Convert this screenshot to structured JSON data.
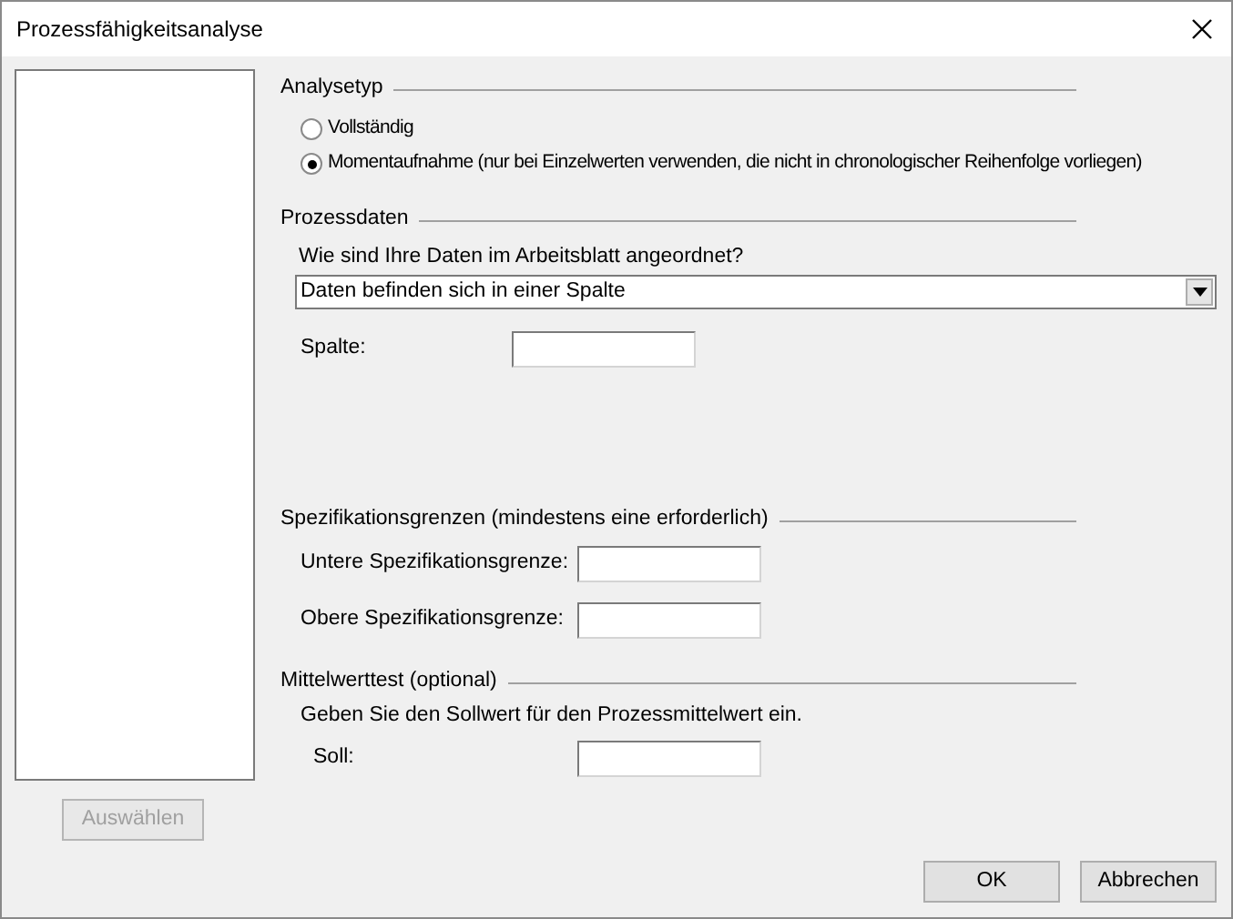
{
  "window": {
    "title": "Prozessfähigkeitsanalyse"
  },
  "select_button": {
    "label": "Auswählen",
    "disabled": true
  },
  "analysis_type": {
    "heading": "Analysetyp",
    "options": [
      {
        "label": "Vollständig",
        "selected": false
      },
      {
        "label": "Momentaufnahme (nur bei Einzelwerten verwenden, die nicht in chronologischer Reihenfolge vorliegen)",
        "selected": true
      }
    ]
  },
  "process_data": {
    "heading": "Prozessdaten",
    "question": "Wie sind Ihre Daten im Arbeitsblatt angeordnet?",
    "arrangement": {
      "value": "Daten befinden sich in einer Spalte"
    },
    "fields": [
      {
        "label": "Spalte:"
      }
    ]
  },
  "spec_limits": {
    "heading": "Spezifikationsgrenzen (mindestens eine erforderlich)",
    "fields": [
      {
        "label": "Untere Spezifikationsgrenze:"
      },
      {
        "label": "Obere Spezifikationsgrenze:"
      }
    ]
  },
  "mean_test": {
    "heading": "Mittelwerttest (optional)",
    "hint": "Geben Sie den Sollwert für den Prozessmittelwert ein.",
    "fields": [
      {
        "label": "Soll:"
      }
    ]
  },
  "buttons": [
    {
      "label": "OK"
    },
    {
      "label": "Abbrechen"
    }
  ]
}
